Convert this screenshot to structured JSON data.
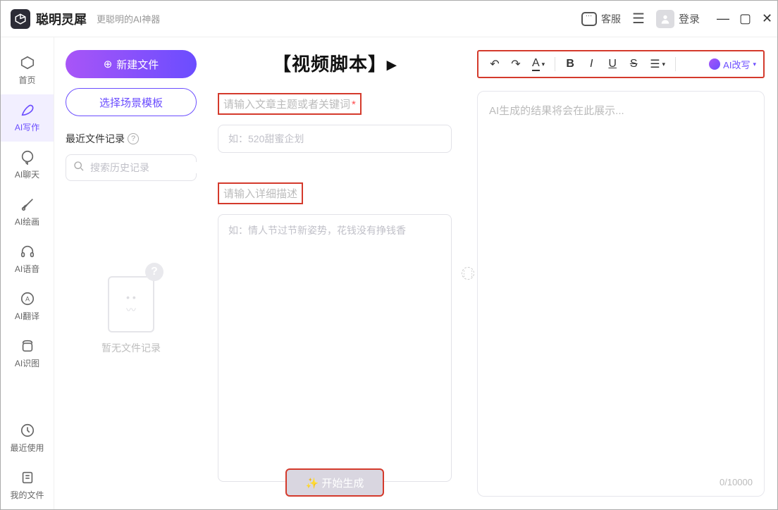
{
  "titlebar": {
    "app_name": "聪明灵犀",
    "app_sub": "更聪明的AI神器",
    "kefu": "客服",
    "login": "登录"
  },
  "sidebar": {
    "items": [
      {
        "label": "首页"
      },
      {
        "label": "AI写作"
      },
      {
        "label": "AI聊天"
      },
      {
        "label": "AI绘画"
      },
      {
        "label": "AI语音"
      },
      {
        "label": "AI翻译"
      },
      {
        "label": "AI识图"
      },
      {
        "label": "最近使用"
      },
      {
        "label": "我的文件"
      }
    ]
  },
  "left_panel": {
    "new_file": "新建文件",
    "choose_template": "选择场景模板",
    "recent_label": "最近文件记录",
    "search_placeholder": "搜索历史记录",
    "empty_text": "暂无文件记录"
  },
  "center": {
    "title": "【视频脚本】▸",
    "field1_label": "请输入文章主题或者关键词",
    "field1_placeholder": "如：520甜蜜企划",
    "field2_label": "请输入详细描述",
    "field2_placeholder": "如：情人节过节新姿势，花钱没有挣钱香",
    "generate_btn": "✨ 开始生成"
  },
  "right": {
    "ai_rewrite": "AI改写",
    "output_placeholder": "AI生成的结果将会在此展示...",
    "char_count": "0/10000"
  }
}
